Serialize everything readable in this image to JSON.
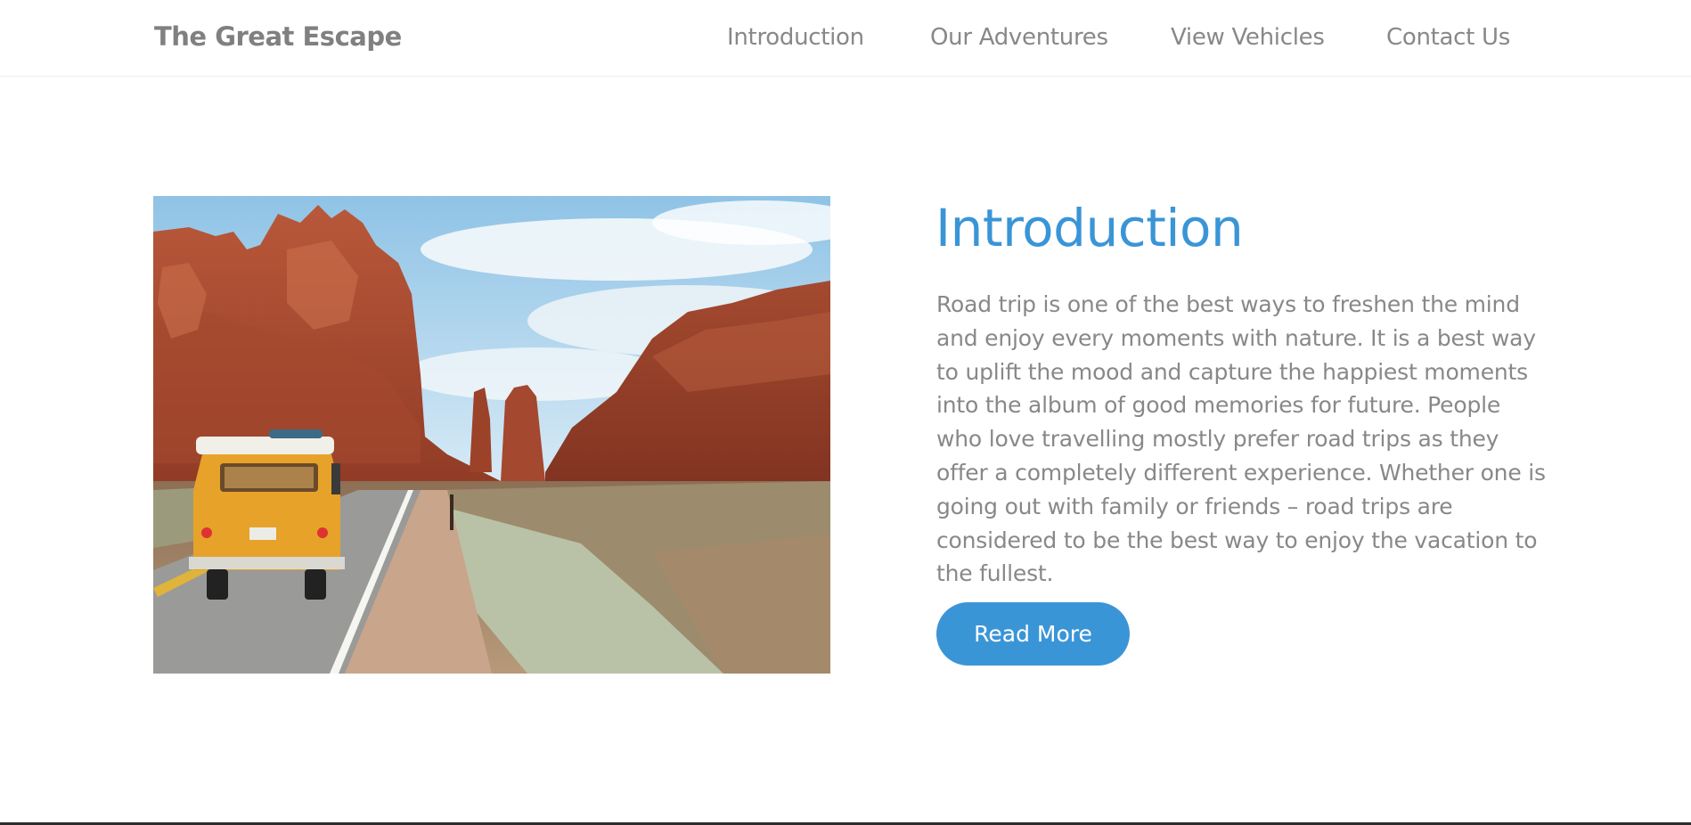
{
  "navbar": {
    "brand": "The Great Escape",
    "links": [
      {
        "label": "Introduction"
      },
      {
        "label": "Our Adventures"
      },
      {
        "label": "View Vehicles"
      },
      {
        "label": "Contact Us"
      }
    ]
  },
  "intro": {
    "heading": "Introduction",
    "body": "Road trip is one of the best ways to freshen the mind and enjoy every moments with nature. It is a best way to uplift the mood and capture the happiest moments into the album of good memories for future. People who love travelling mostly prefer road trips as they offer a completely different experience. Whether one is going out with family or friends – road trips are considered to be the best way to enjoy the vacation to the fullest.",
    "button_label": "Read More"
  },
  "colors": {
    "accent": "#3a95d6",
    "text_muted": "#888888",
    "brand_text": "#808080"
  }
}
